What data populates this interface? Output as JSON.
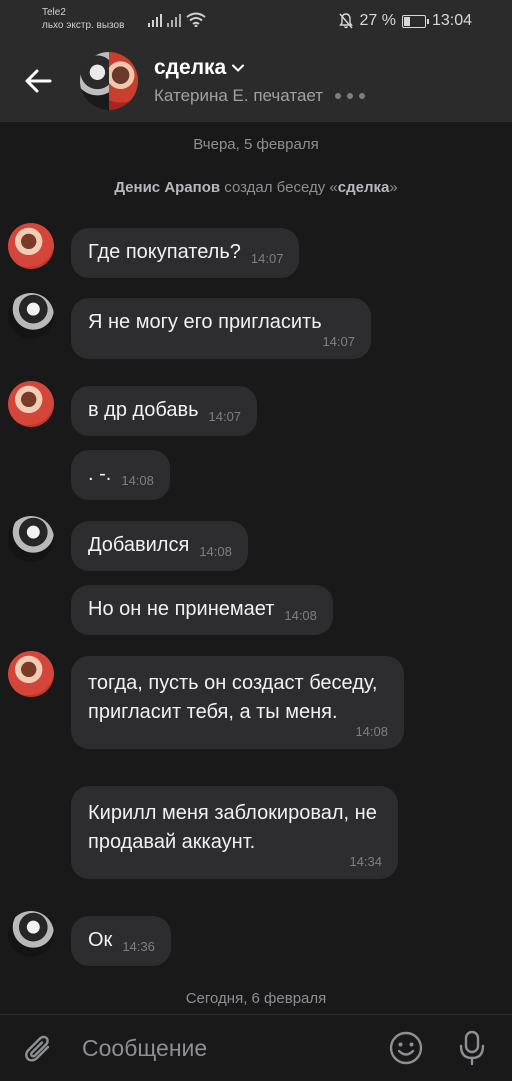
{
  "status_bar": {
    "carrier": "Tele2",
    "carrier_sub": "льхо экстр. вызов",
    "battery": "27 %",
    "time": "13:04"
  },
  "header": {
    "title": "сделка",
    "typing_text": "Катерина Е. печатает"
  },
  "chat": {
    "date_yesterday": "Вчера, 5 февраля",
    "service_name": "Денис Арапов",
    "service_action": " создал беседу «",
    "service_chat": "сделка",
    "service_end": "»",
    "messages": [
      {
        "author": "katerina",
        "text": "Где покупатель?",
        "time": "14:07"
      },
      {
        "author": "denis",
        "text": "Я не могу его пригласить",
        "time": "14:07"
      },
      {
        "author": "katerina",
        "text": "в др добавь",
        "time": "14:07"
      },
      {
        "author": "katerina",
        "text": ". -.",
        "time": "14:08"
      },
      {
        "author": "denis",
        "text": "Добавился",
        "time": "14:08"
      },
      {
        "author": "denis",
        "text": "Но он не принемает",
        "time": "14:08"
      },
      {
        "author": "katerina",
        "text": "тогда, пусть он создаст беседу, пригласит тебя, а ты меня.",
        "time": "14:08"
      },
      {
        "author": "katerina",
        "text": "Кирилл меня заблокировал, не продавай аккаунт.",
        "time": "14:34"
      },
      {
        "author": "denis",
        "text": "Ок",
        "time": "14:36"
      }
    ],
    "date_today": "Сегодня, 6 февраля"
  },
  "composer": {
    "placeholder": "Сообщение"
  },
  "icons": {
    "back": "arrow-left-icon",
    "chevron": "chevron-down-icon",
    "attach": "paperclip-icon",
    "emoji": "smile-icon",
    "mic": "microphone-icon",
    "mute": "bell-off-icon",
    "signal": "signal-icon",
    "wifi": "wifi-icon",
    "battery": "battery-icon"
  },
  "colors": {
    "background": "#19191a",
    "header": "#2b2b2c",
    "bubble": "#2d2d2f",
    "text": "#f0f1f3",
    "muted": "#8d8f93"
  }
}
